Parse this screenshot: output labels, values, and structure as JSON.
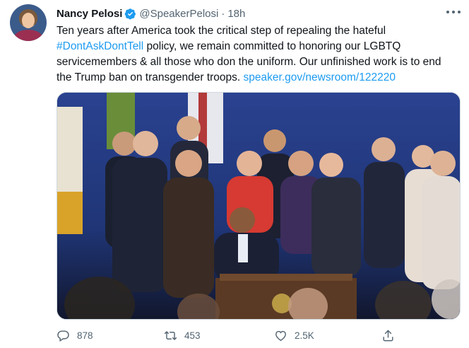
{
  "author": {
    "name": "Nancy Pelosi",
    "handle": "@SpeakerPelosi",
    "separator": "·",
    "time": "18h",
    "verified": true
  },
  "tweet": {
    "text_1": "Ten years after America took the critical step of repealing the hateful ",
    "hashtag": "#DontAskDontTell",
    "text_2": " policy, we remain committed to honoring our LGBTQ servicemembers & all those who don the uniform. Our unfinished work is to end the Trump ban on transgender troops. ",
    "link": "speaker.gov/newsroom/122220"
  },
  "actions": {
    "replies": "878",
    "retweets": "453",
    "likes": "2.5K"
  },
  "colors": {
    "link": "#1d9bf0",
    "secondary_text": "#536471",
    "verified_badge": "#1d9bf0"
  },
  "icons": [
    "verified-badge-icon",
    "more-icon",
    "reply-icon",
    "retweet-icon",
    "like-icon",
    "share-icon"
  ]
}
